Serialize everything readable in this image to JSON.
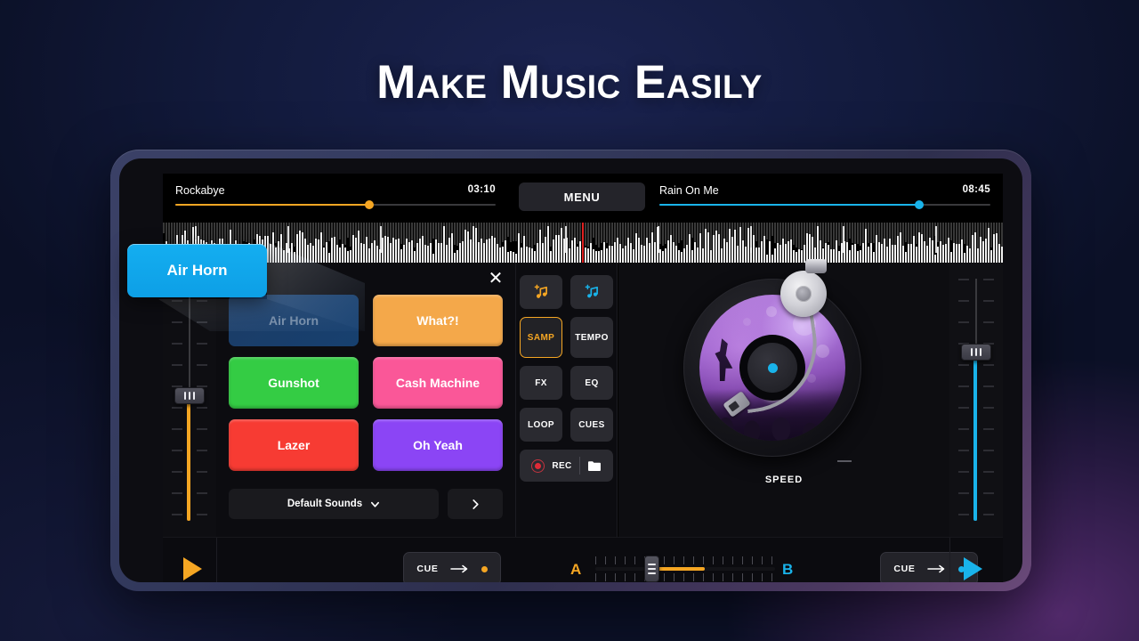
{
  "hero": {
    "title": "Make Music Easily"
  },
  "decks": {
    "left": {
      "track_name": "Rockabye",
      "time": "03:10",
      "progress": 0.605,
      "color": "#f5a623",
      "cue_label": "CUE",
      "play_icon": "play-icon",
      "fader_value": 0.52
    },
    "right": {
      "track_name": "Rain On Me",
      "time": "08:45",
      "progress": 0.785,
      "color": "#19b3ea",
      "cue_label": "CUE",
      "play_icon": "play-icon",
      "fader_value": 0.7
    }
  },
  "menu": {
    "label": "MENU"
  },
  "waveform": {
    "playhead_position": 0.499
  },
  "sampler": {
    "close_icon": "close-icon",
    "pads": [
      {
        "label": "Air Horn",
        "color": "#1a9ee8",
        "state": "dimmed"
      },
      {
        "label": "What?!",
        "color": "#f4a84a",
        "state": "normal"
      },
      {
        "label": "Gunshot",
        "color": "#34cc44",
        "state": "normal"
      },
      {
        "label": "Cash Machine",
        "color": "#fa5798",
        "state": "normal"
      },
      {
        "label": "Lazer",
        "color": "#f73b33",
        "state": "normal"
      },
      {
        "label": "Oh Yeah",
        "color": "#8b45f5",
        "state": "normal"
      }
    ],
    "select_label": "Default Sounds",
    "select_icon": "chevron-down-icon",
    "next_icon": "chevron-right-icon"
  },
  "callout": {
    "label": "Air Horn"
  },
  "controls": {
    "add_music_a": "add-music-orange-icon",
    "add_music_b": "add-music-cyan-icon",
    "buttons": [
      {
        "label": "SAMP",
        "active": true
      },
      {
        "label": "TEMPO",
        "active": false
      },
      {
        "label": "FX",
        "active": false
      },
      {
        "label": "EQ",
        "active": false
      },
      {
        "label": "LOOP",
        "active": false
      },
      {
        "label": "CUES",
        "active": false
      }
    ],
    "rec_label": "REC",
    "rec_icon": "record-icon",
    "folder_icon": "folder-icon"
  },
  "deck_display": {
    "speed_label": "SPEED",
    "minus_icon": "minus-icon",
    "plus_icon": "plus-icon",
    "album_art": "concert-crowd-purple"
  },
  "crossfader": {
    "label_a": "A",
    "label_b": "B",
    "position": 0.31
  },
  "colors": {
    "accent_a": "#f5a623",
    "accent_b": "#19b3ea",
    "panel": "#0c0c10",
    "screen": "#000000"
  }
}
